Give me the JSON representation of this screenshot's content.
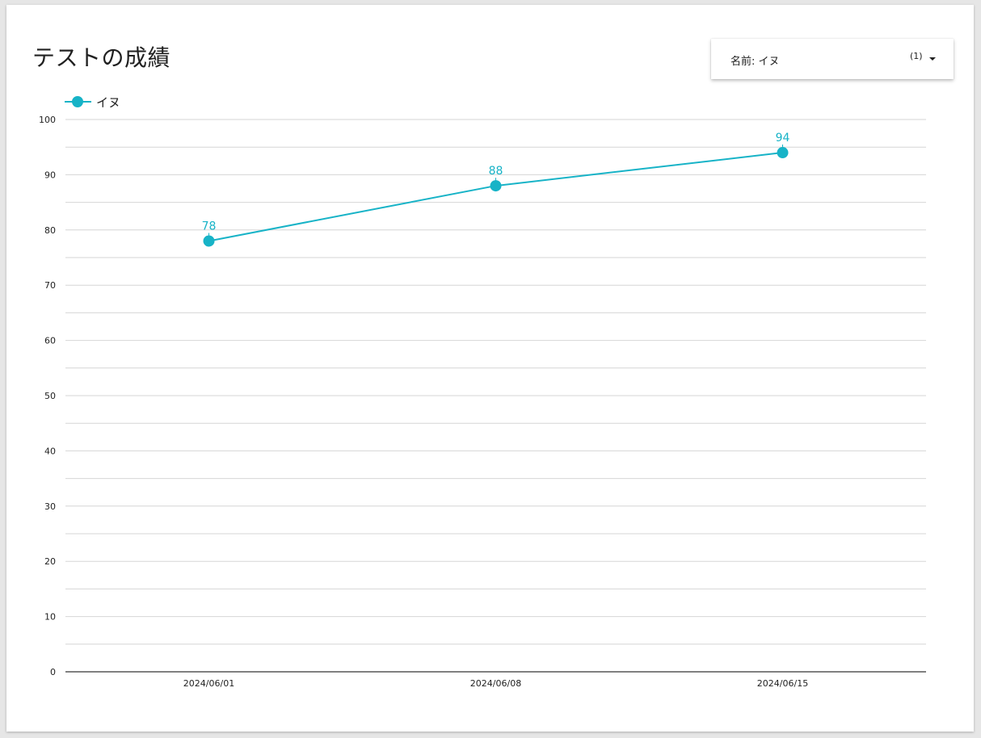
{
  "title": "テストの成績",
  "filter": {
    "label": "名前: イヌ",
    "count": "(1)"
  },
  "colors": {
    "series": "#17b3c7",
    "grid": "#d6d6d6",
    "axis": "#000000"
  },
  "chart_data": {
    "type": "line",
    "categories": [
      "2024/06/01",
      "2024/06/08",
      "2024/06/15"
    ],
    "series": [
      {
        "name": "イヌ",
        "values": [
          78,
          88,
          94
        ],
        "data_labels": [
          "78",
          "88",
          "94"
        ]
      }
    ],
    "ylim": [
      0,
      100
    ],
    "yticks": [
      0,
      10,
      20,
      30,
      40,
      50,
      60,
      70,
      80,
      90,
      100
    ],
    "minor_grid_step": 5,
    "grid": true,
    "legend_position": "top-left"
  }
}
